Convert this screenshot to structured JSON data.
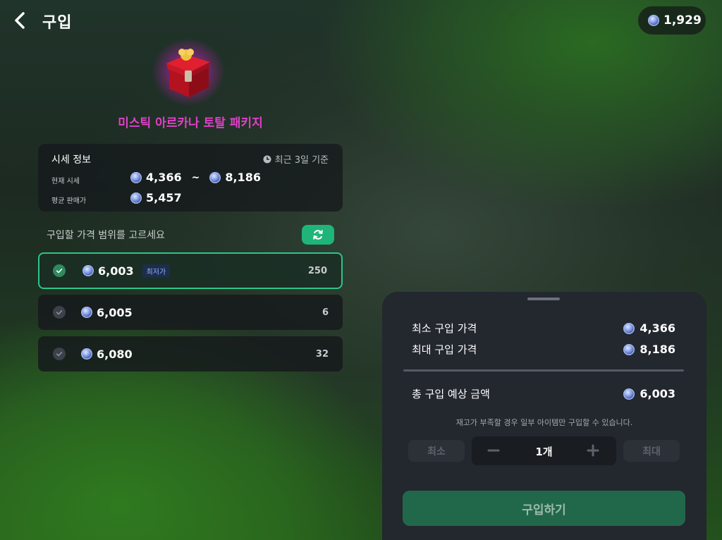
{
  "header": {
    "title": "구입",
    "balance": "1,929"
  },
  "item": {
    "name": "미스틱 아르카나 토탈 패키지",
    "image_icon": "treasure-chest-icon"
  },
  "market": {
    "header": "시세 정보",
    "period": "최근 3일 기준",
    "current_label": "현재 시세",
    "current_min": "4,366",
    "current_sep": "~",
    "current_max": "8,186",
    "avg_label": "평균 판매가",
    "avg_value": "5,457"
  },
  "range_label": "구입할 가격 범위를 고르세요",
  "options": [
    {
      "price": "6,003",
      "badge": "최저가",
      "qty": "250",
      "selected": true
    },
    {
      "price": "6,005",
      "qty": "6",
      "selected": false
    },
    {
      "price": "6,080",
      "qty": "32",
      "selected": false
    }
  ],
  "panel": {
    "min_label": "최소 구입 가격",
    "min_value": "4,366",
    "max_label": "최대 구입 가격",
    "max_value": "8,186",
    "total_label": "총 구입 예상 금액",
    "total_value": "6,003",
    "notice": "재고가 부족할 경우 일부 아이템만 구입할 수 있습니다.",
    "min_button": "최소",
    "max_button": "최대",
    "quantity": "1개",
    "buy_button": "구입하기"
  },
  "colors": {
    "accent": "#2ec48a",
    "item_name": "#e040c8",
    "buy_button": "#21684a"
  }
}
